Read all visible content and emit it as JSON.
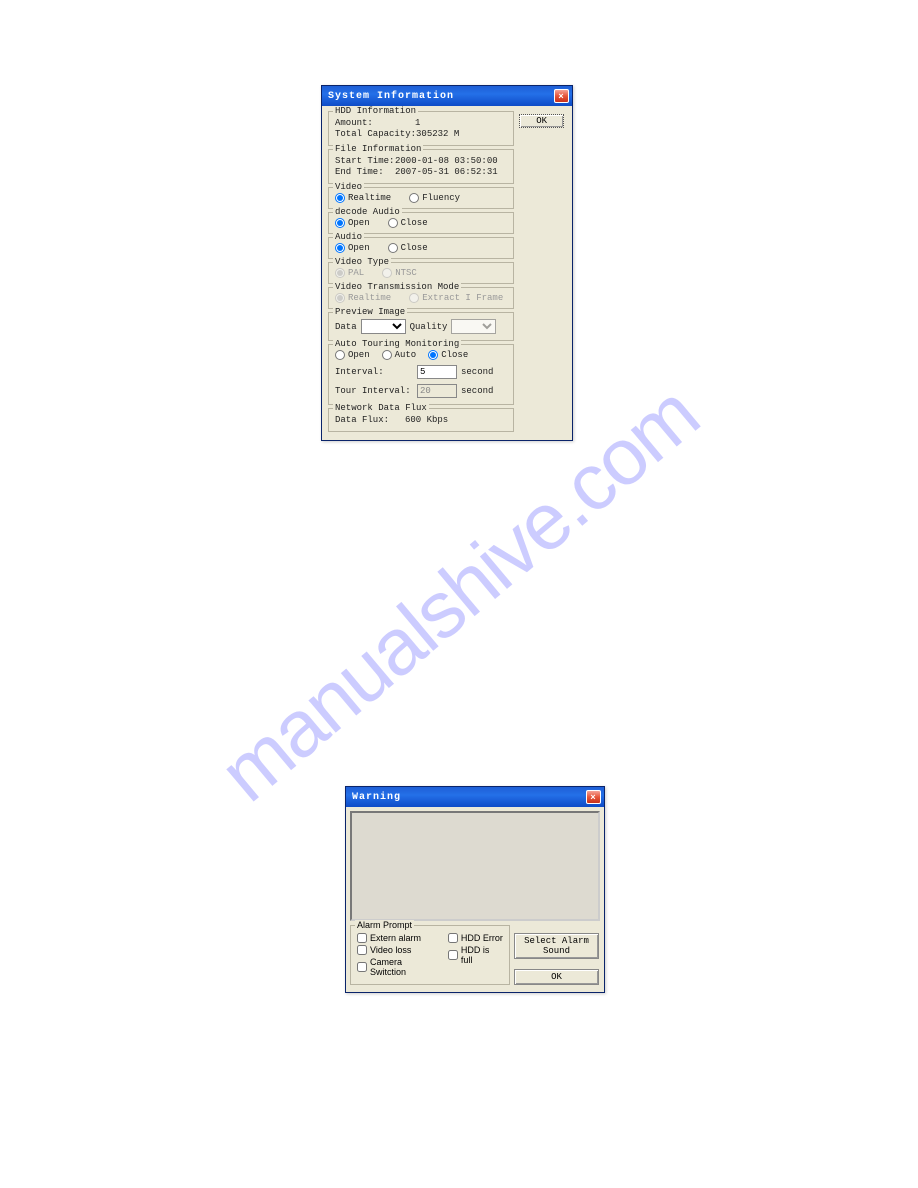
{
  "watermark": "manualshive.com",
  "win1": {
    "title": "System Information",
    "close_glyph": "×",
    "ok_label": "OK",
    "hdd": {
      "legend": "HDD Information",
      "amount_label": "Amount:",
      "amount_value": "1",
      "capacity_label": "Total Capacity:",
      "capacity_value": "305232 M"
    },
    "file": {
      "legend": "File Information",
      "start_label": "Start Time:",
      "start_value": "2000-01-08  03:50:00",
      "end_label": "End Time:",
      "end_value": "2007-05-31  06:52:31"
    },
    "video": {
      "legend": "Video",
      "opt1": "Realtime",
      "opt2": "Fluency"
    },
    "decode_audio": {
      "legend": "decode Audio",
      "opt1": "Open",
      "opt2": "Close"
    },
    "audio": {
      "legend": "Audio",
      "opt1": "Open",
      "opt2": "Close"
    },
    "video_type": {
      "legend": "Video Type",
      "opt1": "PAL",
      "opt2": "NTSC"
    },
    "video_trans": {
      "legend": "Video Transmission Mode",
      "opt1": "Realtime",
      "opt2": "Extract I Frame"
    },
    "preview": {
      "legend": "Preview Image",
      "data_label": "Data",
      "quality_label": "Quality"
    },
    "touring": {
      "legend": "Auto Touring Monitoring",
      "opt1": "Open",
      "opt2": "Auto",
      "opt3": "Close",
      "interval_label": "Interval:",
      "interval_value": "5",
      "interval_unit": "second",
      "tour_label": "Tour Interval:",
      "tour_value": "20",
      "tour_unit": "second"
    },
    "netflux": {
      "legend": "Network Data Flux",
      "label": "Data Flux:",
      "value": "600 Kbps"
    }
  },
  "win2": {
    "title": "Warning",
    "close_glyph": "×",
    "alarm": {
      "legend": "Alarm Prompt",
      "cb1": "Extern alarm",
      "cb2": "HDD Error",
      "cb3": "Video loss",
      "cb4": "HDD is full",
      "cb5": "Camera Switction"
    },
    "select_sound": "Select Alarm Sound",
    "ok_label": "OK"
  }
}
